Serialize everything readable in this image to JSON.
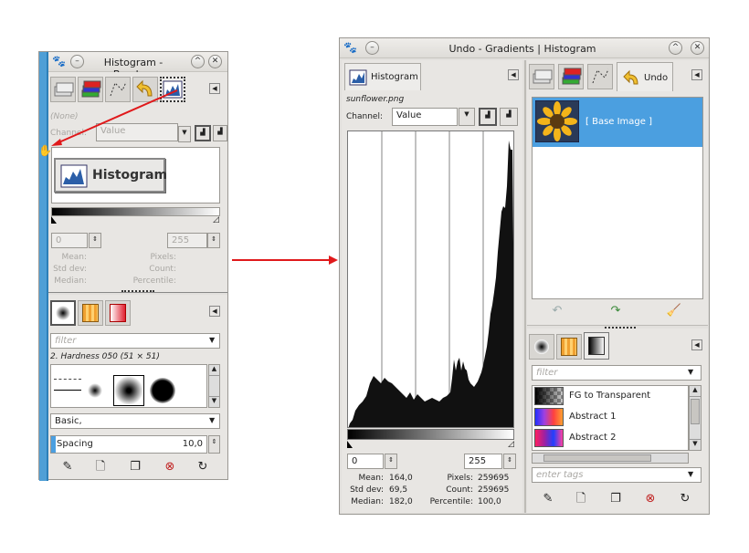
{
  "left": {
    "title": "Histogram - Brushes",
    "drag_button_label": "Histogram",
    "none_label": "(None)",
    "channel_label": "Channel:",
    "channel_value": "Value",
    "spin_min": "0",
    "spin_max": "255",
    "stats_left": [
      "Mean:",
      "Std dev:",
      "Median:"
    ],
    "stats_right": [
      "Pixels:",
      "Count:",
      "Percentile:"
    ],
    "filter_placeholder": "filter",
    "brush_name": "2. Hardness 050 (51 × 51)",
    "preset": "Basic,",
    "spacing_label": "Spacing",
    "spacing_value": "10,0"
  },
  "right": {
    "title": "Undo - Gradients | Histogram",
    "histogram_tab": "Histogram",
    "filename": "sunflower.png",
    "channel_label": "Channel:",
    "channel_value": "Value",
    "spin_min": "0",
    "spin_max": "255",
    "stats": [
      {
        "label": "Mean:",
        "value": "164,0"
      },
      {
        "label": "Std dev:",
        "value": "69,5"
      },
      {
        "label": "Median:",
        "value": "182,0"
      }
    ],
    "stats2": [
      {
        "label": "Pixels:",
        "value": "259695"
      },
      {
        "label": "Count:",
        "value": "259695"
      },
      {
        "label": "Percentile:",
        "value": "100,0"
      }
    ],
    "undo_tab": "Undo",
    "undo_item": "[ Base Image ]",
    "filter_placeholder": "filter",
    "gradients": [
      "FG to Transparent",
      "Abstract 1",
      "Abstract 2"
    ],
    "tags_placeholder": "enter tags"
  },
  "colors": {
    "selection": "#4b9fe0",
    "arrow": "#e0191b"
  }
}
